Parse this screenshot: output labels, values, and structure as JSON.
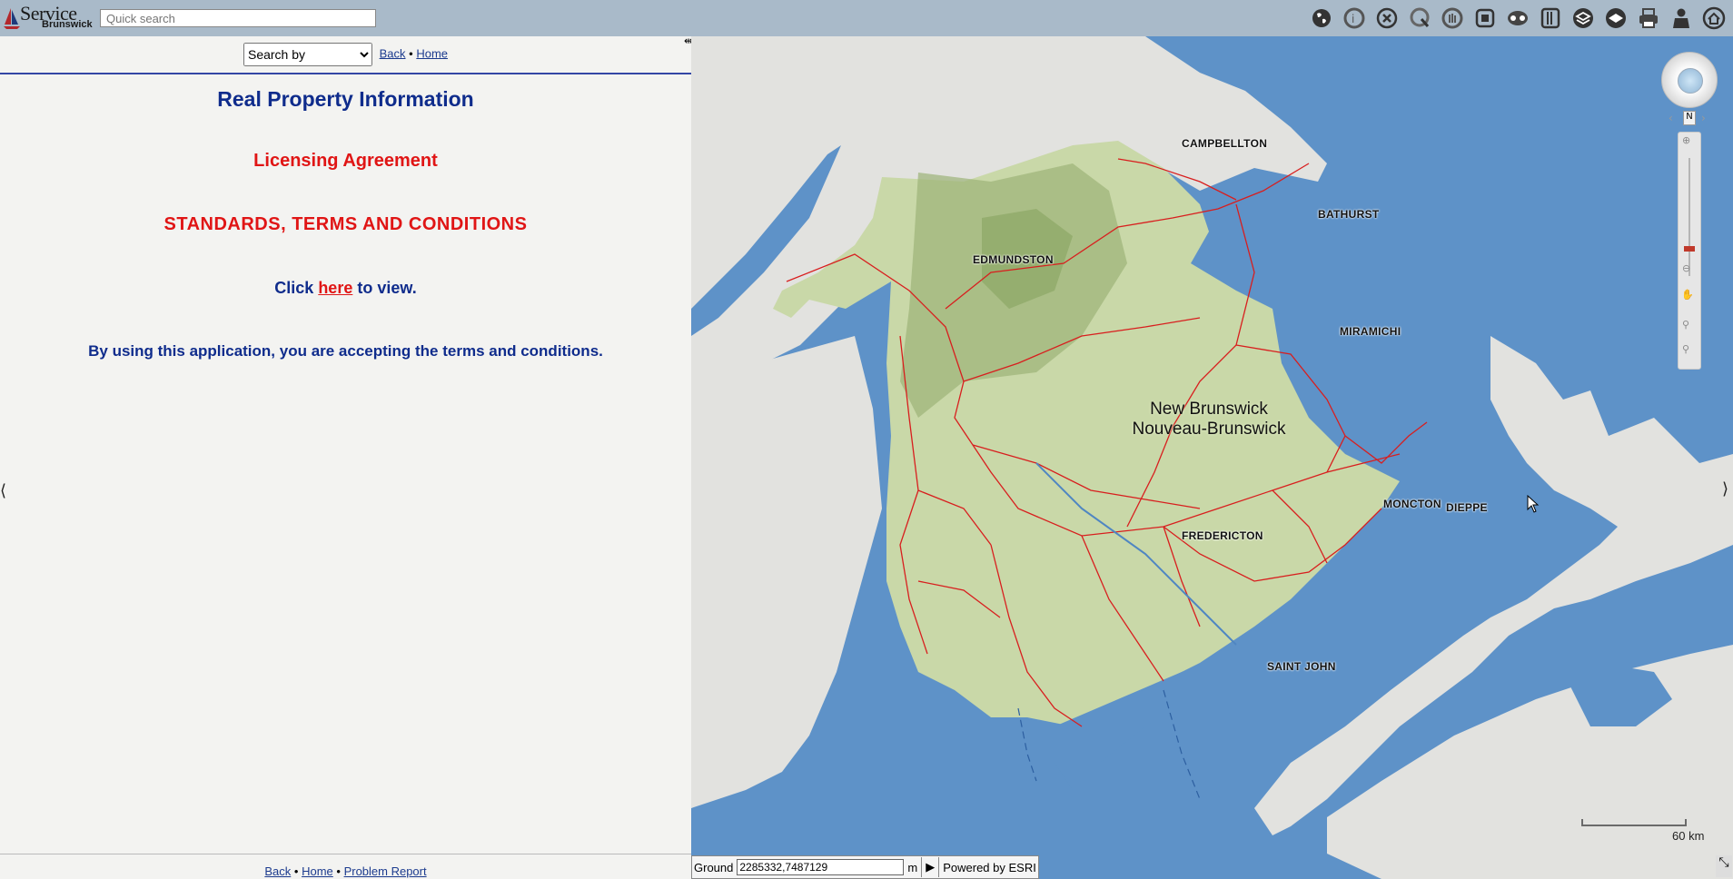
{
  "app": {
    "logo_word1": "Service",
    "logo_word2": "Brunswick",
    "quick_search_placeholder": "Quick search"
  },
  "toolbar": {
    "icons": [
      "globe-icon",
      "identify-icon",
      "clear-icon",
      "select-icon",
      "pan-icon",
      "extent-icon",
      "network-icon",
      "measure-icon",
      "layers-icon",
      "basemap-icon",
      "print-icon",
      "user-icon",
      "home-icon"
    ]
  },
  "left": {
    "search_select": "Search by",
    "back": "Back",
    "sep": "•",
    "home": "Home",
    "title": "Real Property Information",
    "licensing": "Licensing Agreement",
    "terms_title": "STANDARDS, TERMS AND CONDITIONS",
    "click_pre": "Click",
    "click_link": "here",
    "click_post": "to view.",
    "accept": "By using this application, you are accepting the terms and conditions.",
    "footer": {
      "back": "Back",
      "home": "Home",
      "problem": "Problem Report"
    }
  },
  "map": {
    "province_en": "New Brunswick",
    "province_fr": "Nouveau-Brunswick",
    "cities": {
      "campbellton": "CAMPBELLTON",
      "bathurst": "BATHURST",
      "edmundston": "EDMUNDSTON",
      "miramichi": "MIRAMICHI",
      "moncton": "MONCTON",
      "dieppe": "DIEPPE",
      "fredericton": "FREDERICTON",
      "saint_john": "SAINT JOHN"
    },
    "north_label": "N",
    "scale_label": "60 km",
    "coord_label": "Ground",
    "coord_value": "2285332,7487129",
    "coord_unit": "m",
    "powered": "Powered by ESRI",
    "colors": {
      "water": "#5e92c8",
      "land": "#e2e2df",
      "province": "#c9d8a8",
      "roads": "#d81e1e"
    }
  }
}
